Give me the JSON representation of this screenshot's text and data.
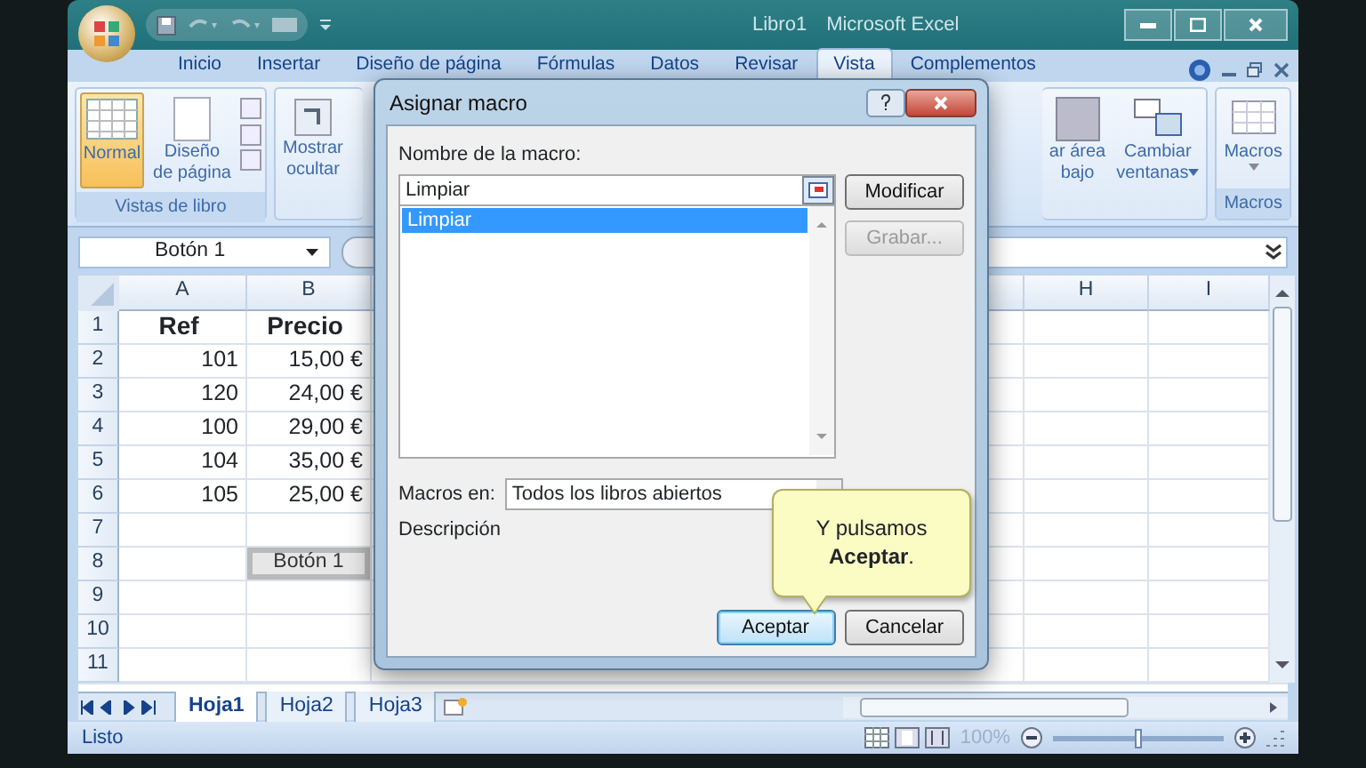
{
  "window": {
    "title_doc": "Libro1",
    "title_app": "Microsoft Excel"
  },
  "ribbon_tabs": [
    {
      "label": "Inicio",
      "selected": false
    },
    {
      "label": "Insertar",
      "selected": false
    },
    {
      "label": "Diseño de página",
      "selected": false
    },
    {
      "label": "Fórmulas",
      "selected": false
    },
    {
      "label": "Datos",
      "selected": false
    },
    {
      "label": "Revisar",
      "selected": false
    },
    {
      "label": "Vista",
      "selected": true
    },
    {
      "label": "Complementos",
      "selected": false
    }
  ],
  "ribbon_left": {
    "group_label": "Vistas de libro",
    "buttons": [
      {
        "lines": [
          "Normal"
        ],
        "selected": true
      },
      {
        "lines": [
          "Diseño",
          "de página"
        ],
        "selected": false
      }
    ],
    "partial_button": {
      "lines": [
        "Mostrar",
        "ocultar"
      ]
    }
  },
  "ribbon_right": {
    "buttons": [
      {
        "lines": [
          "ar área",
          "bajo"
        ],
        "kind": "partial"
      },
      {
        "lines": [
          "Cambiar",
          "ventanas"
        ],
        "kind": "dropdown"
      }
    ],
    "macros_group": {
      "button": "Macros",
      "group_label": "Macros"
    }
  },
  "name_box": "Botón 1",
  "columns": [
    "A",
    "B",
    "H",
    "I"
  ],
  "rows": [
    {
      "num": "1",
      "a": "Ref",
      "b": "Precio",
      "kind": "header"
    },
    {
      "num": "2",
      "a": "101",
      "b": "15,00 €",
      "kind": "value"
    },
    {
      "num": "3",
      "a": "120",
      "b": "24,00 €",
      "kind": "value"
    },
    {
      "num": "4",
      "a": "100",
      "b": "29,00 €",
      "kind": "value"
    },
    {
      "num": "5",
      "a": "104",
      "b": "35,00 €",
      "kind": "value"
    },
    {
      "num": "6",
      "a": "105",
      "b": "25,00 €",
      "kind": "value"
    },
    {
      "num": "7"
    },
    {
      "num": "8",
      "b_button": "Botón 1"
    },
    {
      "num": "9"
    },
    {
      "num": "10"
    },
    {
      "num": "11"
    }
  ],
  "sheet_tabs": [
    {
      "label": "Hoja1",
      "selected": true
    },
    {
      "label": "Hoja2",
      "selected": false
    },
    {
      "label": "Hoja3",
      "selected": false
    }
  ],
  "status_bar": {
    "text": "Listo",
    "zoom": "100%",
    "zoom_slider": {
      "level": 0.5
    }
  },
  "dialog": {
    "title": "Asignar macro",
    "name_label": "Nombre de la macro:",
    "name_value": "Limpiar",
    "macros": [
      {
        "label": "Limpiar",
        "selected": true
      }
    ],
    "side_buttons": [
      {
        "label": "Modificar",
        "disabled": false
      },
      {
        "label": "Grabar...",
        "disabled": true
      }
    ],
    "macros_in_label": "Macros en:",
    "macros_in_value": "Todos los libros abiertos",
    "description_label": "Descripción",
    "buttons": [
      {
        "label": "Aceptar",
        "default": true
      },
      {
        "label": "Cancelar",
        "default": false
      }
    ]
  },
  "callout": {
    "text": "Y pulsamos **Aceptar**."
  }
}
